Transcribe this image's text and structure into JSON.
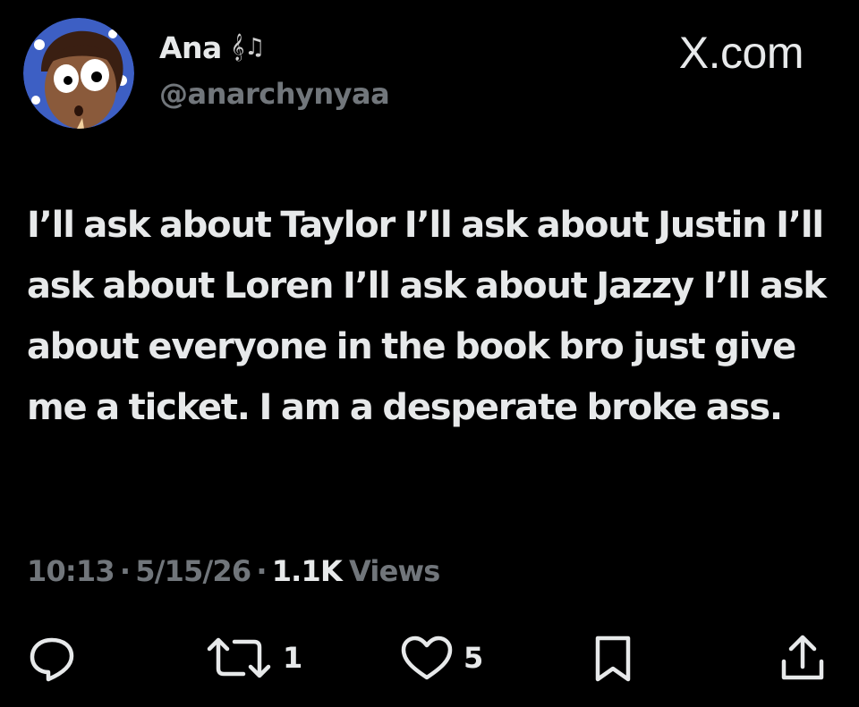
{
  "watermark": "X.com",
  "author": {
    "display_name": "Ana",
    "name_emoji": "𝄞♫",
    "handle": "@anarchynyaa",
    "avatar_icon": "cartoon-face-avatar"
  },
  "tweet": {
    "text": "I’ll ask about Taylor I’ll ask about Justin I’ll ask about Loren I’ll ask about Jazzy I’ll ask about everyone in the book bro just give me a ticket. I am a desperate broke ass.",
    "time": "10:13",
    "date": "5/15/26",
    "separator": "·",
    "views_count": "1.1K",
    "views_label": "Views"
  },
  "actions": {
    "reply": {
      "icon": "reply-icon",
      "count": ""
    },
    "retweet": {
      "icon": "retweet-icon",
      "count": "1"
    },
    "like": {
      "icon": "heart-icon",
      "count": "5"
    },
    "bookmark": {
      "icon": "bookmark-icon"
    },
    "share": {
      "icon": "share-icon"
    }
  },
  "colors": {
    "background": "#000000",
    "text_primary": "#e7e9ea",
    "text_secondary": "#71767b",
    "avatar_bg": "#3d5fc4"
  }
}
